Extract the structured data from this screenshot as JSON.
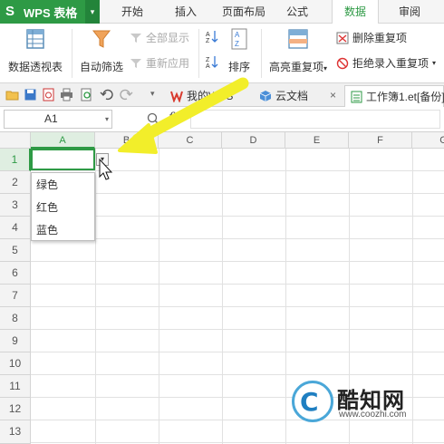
{
  "app": {
    "logo": "S",
    "title": "WPS 表格",
    "caret": "▾",
    "brand_color": "#2e9a45"
  },
  "tabs": [
    {
      "label": "开始"
    },
    {
      "label": "插入"
    },
    {
      "label": "页面布局"
    },
    {
      "label": "公式"
    },
    {
      "label": "数据",
      "active": true
    },
    {
      "label": "审阅"
    }
  ],
  "ribbon": {
    "pivot_table": "数据透视表",
    "auto_filter": "自动筛选",
    "show_all": "全部显示",
    "reapply": "重新应用",
    "sort": "排序",
    "highlight_duplicates": "高亮重复项",
    "highlight_caret": "▾",
    "remove_duplicates": "删除重复项",
    "reject_duplicates": "拒绝录入重复项",
    "reject_caret": "▾"
  },
  "docbar": {
    "more": "▾",
    "my_wps": "我的WPS",
    "cloud_docs": "云文档",
    "workbook": "工作簿1.et[备份]",
    "close": "×"
  },
  "formula_bar": {
    "cell_ref": "A1",
    "caret": "▾",
    "fx": "fx"
  },
  "grid": {
    "columns": [
      "A",
      "B",
      "C",
      "D",
      "E",
      "F",
      "G"
    ],
    "rows": [
      "1",
      "2",
      "3",
      "4",
      "5",
      "6",
      "7",
      "8",
      "9",
      "10",
      "11",
      "12",
      "13"
    ],
    "selected_cell": "A1"
  },
  "dropdown": {
    "button": "▾",
    "options": [
      "绿色",
      "红色",
      "蓝色"
    ]
  },
  "watermark": {
    "logo_letter": "C",
    "name": "酷知网",
    "url": "www.coozhi.com"
  },
  "colors": {
    "accent": "#2e9a45",
    "arrow": "#f2ee2a",
    "watermark": "#1f7fc1"
  }
}
